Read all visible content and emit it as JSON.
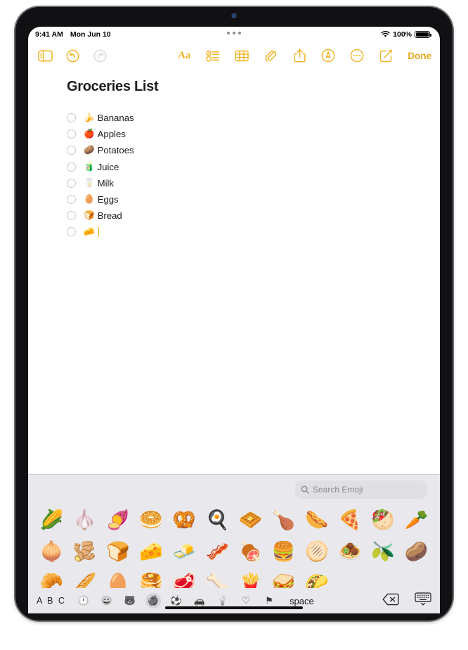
{
  "status_bar": {
    "time": "9:41 AM",
    "date": "Mon Jun 10",
    "wifi_icon": "wifi-icon",
    "battery_percent": "100%",
    "battery_icon": "battery-full-icon"
  },
  "toolbar": {
    "left_items": [
      {
        "name": "sidebar-toggle",
        "icon": "sidebar-icon"
      },
      {
        "name": "undo",
        "icon": "undo-arrow-icon"
      },
      {
        "name": "redo",
        "icon": "redo-arrow-icon",
        "state": "disabled"
      }
    ],
    "right_items": [
      {
        "name": "format-text",
        "icon": "aa-text-format-icon",
        "label": "Aa"
      },
      {
        "name": "checklist",
        "icon": "checklist-icon"
      },
      {
        "name": "table",
        "icon": "table-icon"
      },
      {
        "name": "attachment",
        "icon": "paperclip-icon"
      },
      {
        "name": "share",
        "icon": "share-icon"
      },
      {
        "name": "markup",
        "icon": "markup-pen-circle-icon"
      },
      {
        "name": "more",
        "icon": "ellipsis-circle-icon"
      },
      {
        "name": "compose",
        "icon": "compose-pencil-icon"
      }
    ],
    "done_label": "Done",
    "accent_color": "#f0b323"
  },
  "note": {
    "title": "Groceries List",
    "items": [
      {
        "emoji": "🍌",
        "text": "Bananas",
        "checked": false
      },
      {
        "emoji": "🍎",
        "text": "Apples",
        "checked": false
      },
      {
        "emoji": "🥔",
        "text": "Potatoes",
        "checked": false
      },
      {
        "emoji": "🧃",
        "text": "Juice",
        "checked": false
      },
      {
        "emoji": "🥛",
        "text": "Milk",
        "checked": false
      },
      {
        "emoji": "🥚",
        "text": "Eggs",
        "checked": false
      },
      {
        "emoji": "🍞",
        "text": "Bread",
        "checked": false
      },
      {
        "emoji": "🧀",
        "text": "",
        "checked": false,
        "has_caret": true
      }
    ]
  },
  "keyboard": {
    "search": {
      "placeholder": "Search Emoji",
      "icon": "search-magnifier-icon",
      "value": ""
    },
    "emoji_grid": [
      "🌽",
      "🧄",
      "🍠",
      "🥯",
      "🥨",
      "🍳",
      "🧇",
      "🍗",
      "🌭",
      "🍕",
      "🥙",
      "🥕",
      "🧅",
      "🫚",
      "🍞",
      "🧀",
      "🧈",
      "🥓",
      "🍖",
      "🍔",
      "🫓",
      "🧆",
      "🫒",
      "🥔",
      "🥐",
      "🥖",
      "🥚",
      "🥞",
      "🥩",
      "🦴",
      "🍟",
      "🥪",
      "🌮"
    ],
    "abc_label": "A B C",
    "categories": [
      {
        "name": "recents",
        "icon": "clock-icon",
        "glyph": "🕐",
        "selected": false
      },
      {
        "name": "smileys-people",
        "icon": "smiley-icon",
        "glyph": "😀",
        "selected": false
      },
      {
        "name": "animals-nature",
        "icon": "animal-paw-icon",
        "glyph": "🐻",
        "selected": false
      },
      {
        "name": "food-drink",
        "icon": "apple-icon",
        "glyph": "🍎",
        "selected": true
      },
      {
        "name": "activity",
        "icon": "ball-icon",
        "glyph": "⚽",
        "selected": false
      },
      {
        "name": "travel-places",
        "icon": "car-icon",
        "glyph": "🚗",
        "selected": false
      },
      {
        "name": "objects",
        "icon": "lightbulb-icon",
        "glyph": "💡",
        "selected": false
      },
      {
        "name": "symbols",
        "icon": "heart-icon",
        "glyph": "♡",
        "selected": false
      },
      {
        "name": "flags",
        "icon": "flag-icon",
        "glyph": "⚑",
        "selected": false
      }
    ],
    "space_label": "space",
    "delete_icon": "delete-backward-icon",
    "dismiss_icon": "keyboard-dismiss-icon"
  },
  "colors": {
    "accent": "#f0b323",
    "keyboard_bg": "#e9e9ed",
    "text": "#1c1c1e"
  }
}
